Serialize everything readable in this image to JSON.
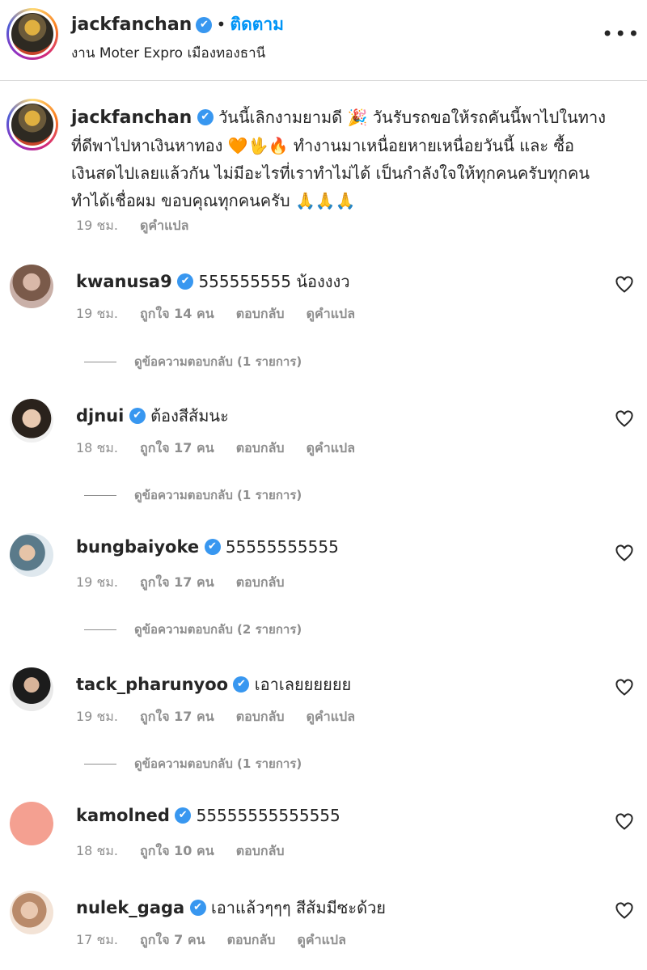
{
  "post": {
    "author": "jackfanchan",
    "follow_label": "ติดตาม",
    "separator": "•",
    "location": "งาน Moter Expro เมืองทองธานี",
    "more_icon": "•••"
  },
  "caption": {
    "username": "jackfanchan",
    "text": "วันนี้เลิกงามยามดี 🎉 วันรับรถขอให้รถคันนี้พาไปในทางที่ดีพาไปหาเงินหาทอง 🧡🖖🔥 ทำงานมาเหนื่อยหายเหนื่อยวันนี้ และ ซื้อเงินสดไปเลยแล้วกัน ไม่มีอะไรที่เราทำไม่ได้ เป็นกำลังใจให้ทุกคนครับทุกคนทำได้เชื่อผม ขอบคุณทุกคนครับ 🙏🙏🙏",
    "time": "19 ชม.",
    "translate": "ดูคำแปล"
  },
  "comments": [
    {
      "username": "kwanusa9",
      "text": "555555555 น้องงงว",
      "time": "19 ชม.",
      "likes": "ถูกใจ 14 คน",
      "reply": "ตอบกลับ",
      "translate": "ดูคำแปล",
      "view_replies": "ดูข้อความตอบกลับ (1 รายการ)"
    },
    {
      "username": "djnui",
      "text": "ต้องสีส้มนะ",
      "time": "18 ชม.",
      "likes": "ถูกใจ 17 คน",
      "reply": "ตอบกลับ",
      "translate": "ดูคำแปล",
      "view_replies": "ดูข้อความตอบกลับ (1 รายการ)"
    },
    {
      "username": "bungbaiyoke",
      "text": "55555555555",
      "time": "19 ชม.",
      "likes": "ถูกใจ 17 คน",
      "reply": "ตอบกลับ",
      "translate": "",
      "view_replies": "ดูข้อความตอบกลับ (2 รายการ)"
    },
    {
      "username": "tack_pharunyoo",
      "text": "เอาเลยยยยยย",
      "time": "19 ชม.",
      "likes": "ถูกใจ 17 คน",
      "reply": "ตอบกลับ",
      "translate": "ดูคำแปล",
      "view_replies": "ดูข้อความตอบกลับ (1 รายการ)"
    },
    {
      "username": "kamolned",
      "text": "55555555555555",
      "time": "18 ชม.",
      "likes": "ถูกใจ 10 คน",
      "reply": "ตอบกลับ",
      "translate": "",
      "view_replies": ""
    },
    {
      "username": "nulek_gaga",
      "text": "เอาแล้วๆๆๆ สีส้มมีซะด้วย",
      "time": "17 ชม.",
      "likes": "ถูกใจ 7 คน",
      "reply": "ตอบกลับ",
      "translate": "ดูคำแปล",
      "view_replies": ""
    }
  ],
  "colors": {
    "verified": "#3897f0",
    "follow": "#0095f6",
    "muted": "#8e8e8e",
    "text": "#262626",
    "kamolned_avatar": "#f4a091"
  },
  "icons": {
    "verified": "verified-badge-icon",
    "heart": "heart-outline-icon",
    "more": "more-options-icon"
  }
}
